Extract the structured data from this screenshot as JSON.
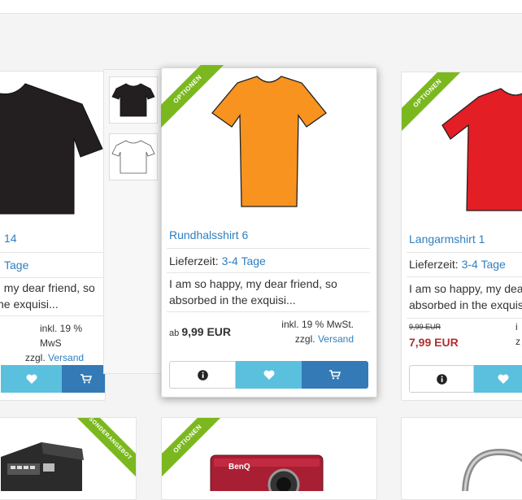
{
  "colors": {
    "link": "#2f7fc0",
    "ribbon": "#7bb81f",
    "fav": "#5bc0de",
    "cart": "#337ab7",
    "sale": "#b03030"
  },
  "icons": {
    "info": "info-circle-icon",
    "favorite": "heart-icon",
    "cart": "shopping-cart-icon"
  },
  "products": [
    {
      "name": "14",
      "lieferzeit_label": "Lieferzeit:",
      "lieferzeit_value": "Tage",
      "desc_line1": ", my dear friend, so",
      "desc_line2": "he exquisi...",
      "tax_line1": "inkl. 19 % MwS",
      "tax_prefix": "zzgl.",
      "tax_link": "Versand",
      "shirt_color": "#231f20"
    },
    {
      "name": "Rundhalsshirt 6",
      "ribbon": "OPTIONEN",
      "lieferzeit_label": "Lieferzeit:",
      "lieferzeit_value": "3-4 Tage",
      "desc_line1": "I am so happy, my dear friend, so",
      "desc_line2": "absorbed in the exquisi...",
      "price_prefix": "ab",
      "price": "9,99 EUR",
      "tax_line1": "inkl. 19 % MwSt.",
      "tax_prefix": "zzgl.",
      "tax_link": "Versand",
      "shirt_color": "#f7931e"
    },
    {
      "name": "Langarmshirt 1",
      "ribbon": "OPTIONEN",
      "lieferzeit_label": "Lieferzeit:",
      "lieferzeit_value": "3-4 Tage",
      "desc_line1": "I am so happy, my dea",
      "desc_line2": "absorbed in the exquis",
      "old_price": "9,99 EUR",
      "price": "7,99 EUR",
      "tax_line1": "i",
      "tax_prefix": "z",
      "shirt_color": "#e31e24"
    }
  ],
  "bottom_row": [
    {
      "ribbon": "SONDERANGEBOT"
    },
    {
      "ribbon": "OPTIONEN",
      "brand": "BenQ"
    },
    {}
  ]
}
